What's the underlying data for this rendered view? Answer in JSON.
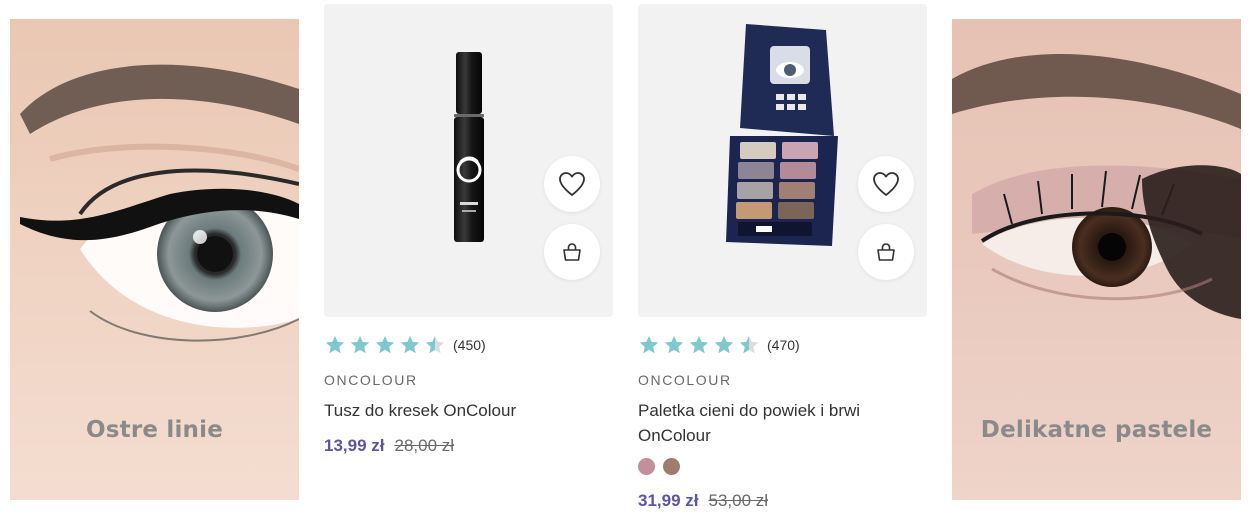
{
  "banners": [
    {
      "label": "Ostre linie"
    },
    {
      "label": "Delikatne pastele"
    }
  ],
  "products": [
    {
      "rating": 4.5,
      "rating_count": "(450)",
      "brand": "ONCOLOUR",
      "name": "Tusz do kresek OnColour",
      "price": "13,99 zł",
      "old_price": "28,00 zł",
      "image_icon": "eyeliner-tube"
    },
    {
      "rating": 4.5,
      "rating_count": "(470)",
      "brand": "ONCOLOUR",
      "name": "Paletka cieni do powiek i brwi OnColour",
      "price": "31,99 zł",
      "old_price": "53,00 zł",
      "image_icon": "eyeshadow-palette",
      "swatches": [
        "#c38f9d",
        "#a07b6e"
      ]
    }
  ],
  "colors": {
    "star": "#7ec9d0",
    "star_empty": "#dcdcdc",
    "price": "#5b55a5"
  },
  "icons": [
    "heart-icon",
    "shopping-bag-icon",
    "star-icon"
  ]
}
